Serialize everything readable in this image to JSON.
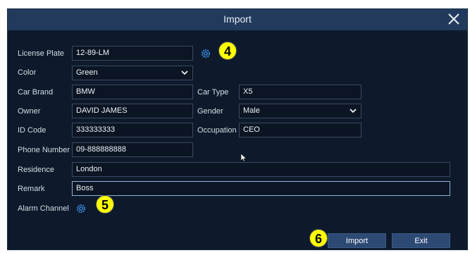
{
  "dialog": {
    "title": "Import",
    "close_icon": "close-icon"
  },
  "form": {
    "license_plate": {
      "label": "License Plate",
      "value": "12-89-LM"
    },
    "color": {
      "label": "Color",
      "value": "Green"
    },
    "car_brand": {
      "label": "Car Brand",
      "value": "BMW"
    },
    "car_type": {
      "label": "Car Type",
      "value": "X5"
    },
    "owner": {
      "label": "Owner",
      "value": "DAVID JAMES"
    },
    "gender": {
      "label": "Gender",
      "value": "Male"
    },
    "id_code": {
      "label": "ID Code",
      "value": "333333333"
    },
    "occupation": {
      "label": "Occupation",
      "value": "CEO"
    },
    "phone_number": {
      "label": "Phone Number",
      "value": "09-888888888"
    },
    "residence": {
      "label": "Residence",
      "value": "London"
    },
    "remark": {
      "label": "Remark",
      "value": "Boss"
    },
    "alarm_channel": {
      "label": "Alarm Channel"
    }
  },
  "buttons": {
    "import_label": "Import",
    "exit_label": "Exit"
  },
  "annotations": {
    "badge_4": "4",
    "badge_5": "5",
    "badge_6": "6"
  },
  "colors": {
    "dialog_bg": "#0e1a2b",
    "titlebar_bg": "#223a5c",
    "accent_gear": "#3a8ee6",
    "button_bg": "#2c4a74",
    "badge_bg": "#ffff00"
  }
}
